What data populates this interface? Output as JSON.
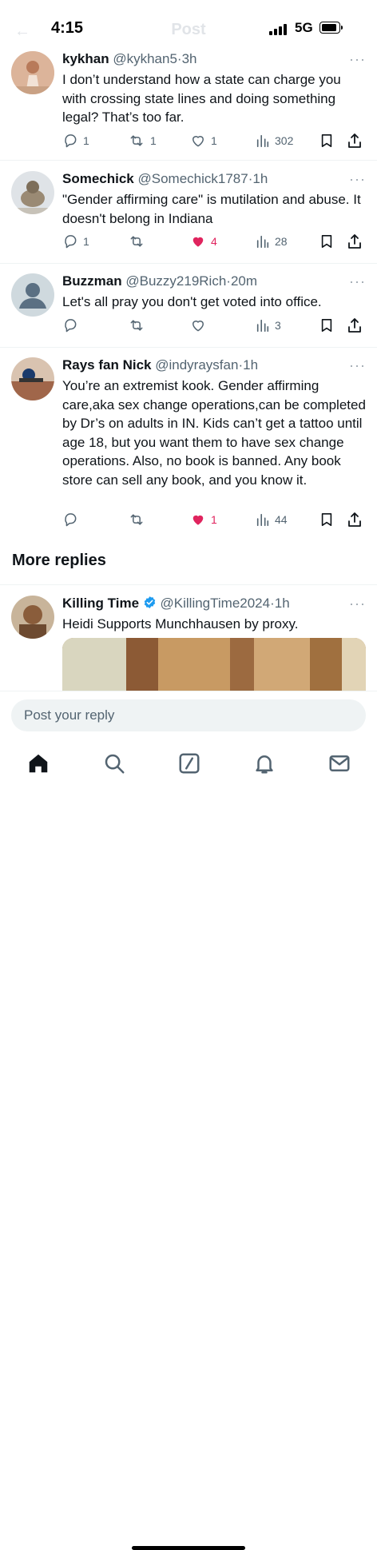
{
  "status": {
    "time": "4:15",
    "network": "5G"
  },
  "header": {
    "title": "Post"
  },
  "tweets": [
    {
      "name": "kykhan",
      "handle": "@kykhan5",
      "sep": "·",
      "time": "3h",
      "text": "I don’t understand how a state can charge you with crossing state lines and doing something legal?  That’s too far.",
      "replies": "1",
      "reposts": "1",
      "likes": "1",
      "views": "302",
      "liked": false
    },
    {
      "name": "Somechick",
      "handle": "@Somechick1787",
      "sep": "·",
      "time": "1h",
      "text": "\"Gender affirming care\" is mutilation and abuse. It doesn't belong in Indiana",
      "replies": "1",
      "reposts": "",
      "likes": "4",
      "views": "28",
      "liked": true
    },
    {
      "name": "Buzzman",
      "handle": "@Buzzy219Rich",
      "sep": "·",
      "time": "20m",
      "text": "Let's all pray you don't get voted into office.",
      "replies": "",
      "reposts": "",
      "likes": "",
      "views": "3",
      "liked": false
    },
    {
      "name": "Rays fan Nick",
      "handle": "@indyraysfan",
      "sep": "·",
      "time": "1h",
      "text": "You’re an extremist kook. Gender affirming care,aka sex change operations,can be completed by Dr’s on adults in IN. Kids can’t get a tattoo until age 18, but you want them to have sex change operations. Also, no book is banned. Any book store can sell any book, and you know it.",
      "replies": "",
      "reposts": "",
      "likes": "1",
      "views": "44",
      "liked": true
    }
  ],
  "more_replies": {
    "heading": "More replies",
    "tweet": {
      "name": "Killing Time",
      "verified": true,
      "handle": "@KillingTime2024",
      "sep": "·",
      "time": "1h",
      "text": "Heidi Supports Munchhausen by proxy."
    }
  },
  "reply_input": {
    "placeholder": "Post your reply"
  },
  "tabs": [
    "home-icon",
    "search-icon",
    "grok-icon",
    "notifications-icon",
    "messages-icon"
  ],
  "colors": {
    "like": "#e0245e",
    "muted": "#536471",
    "verified": "#1d9bf0"
  }
}
